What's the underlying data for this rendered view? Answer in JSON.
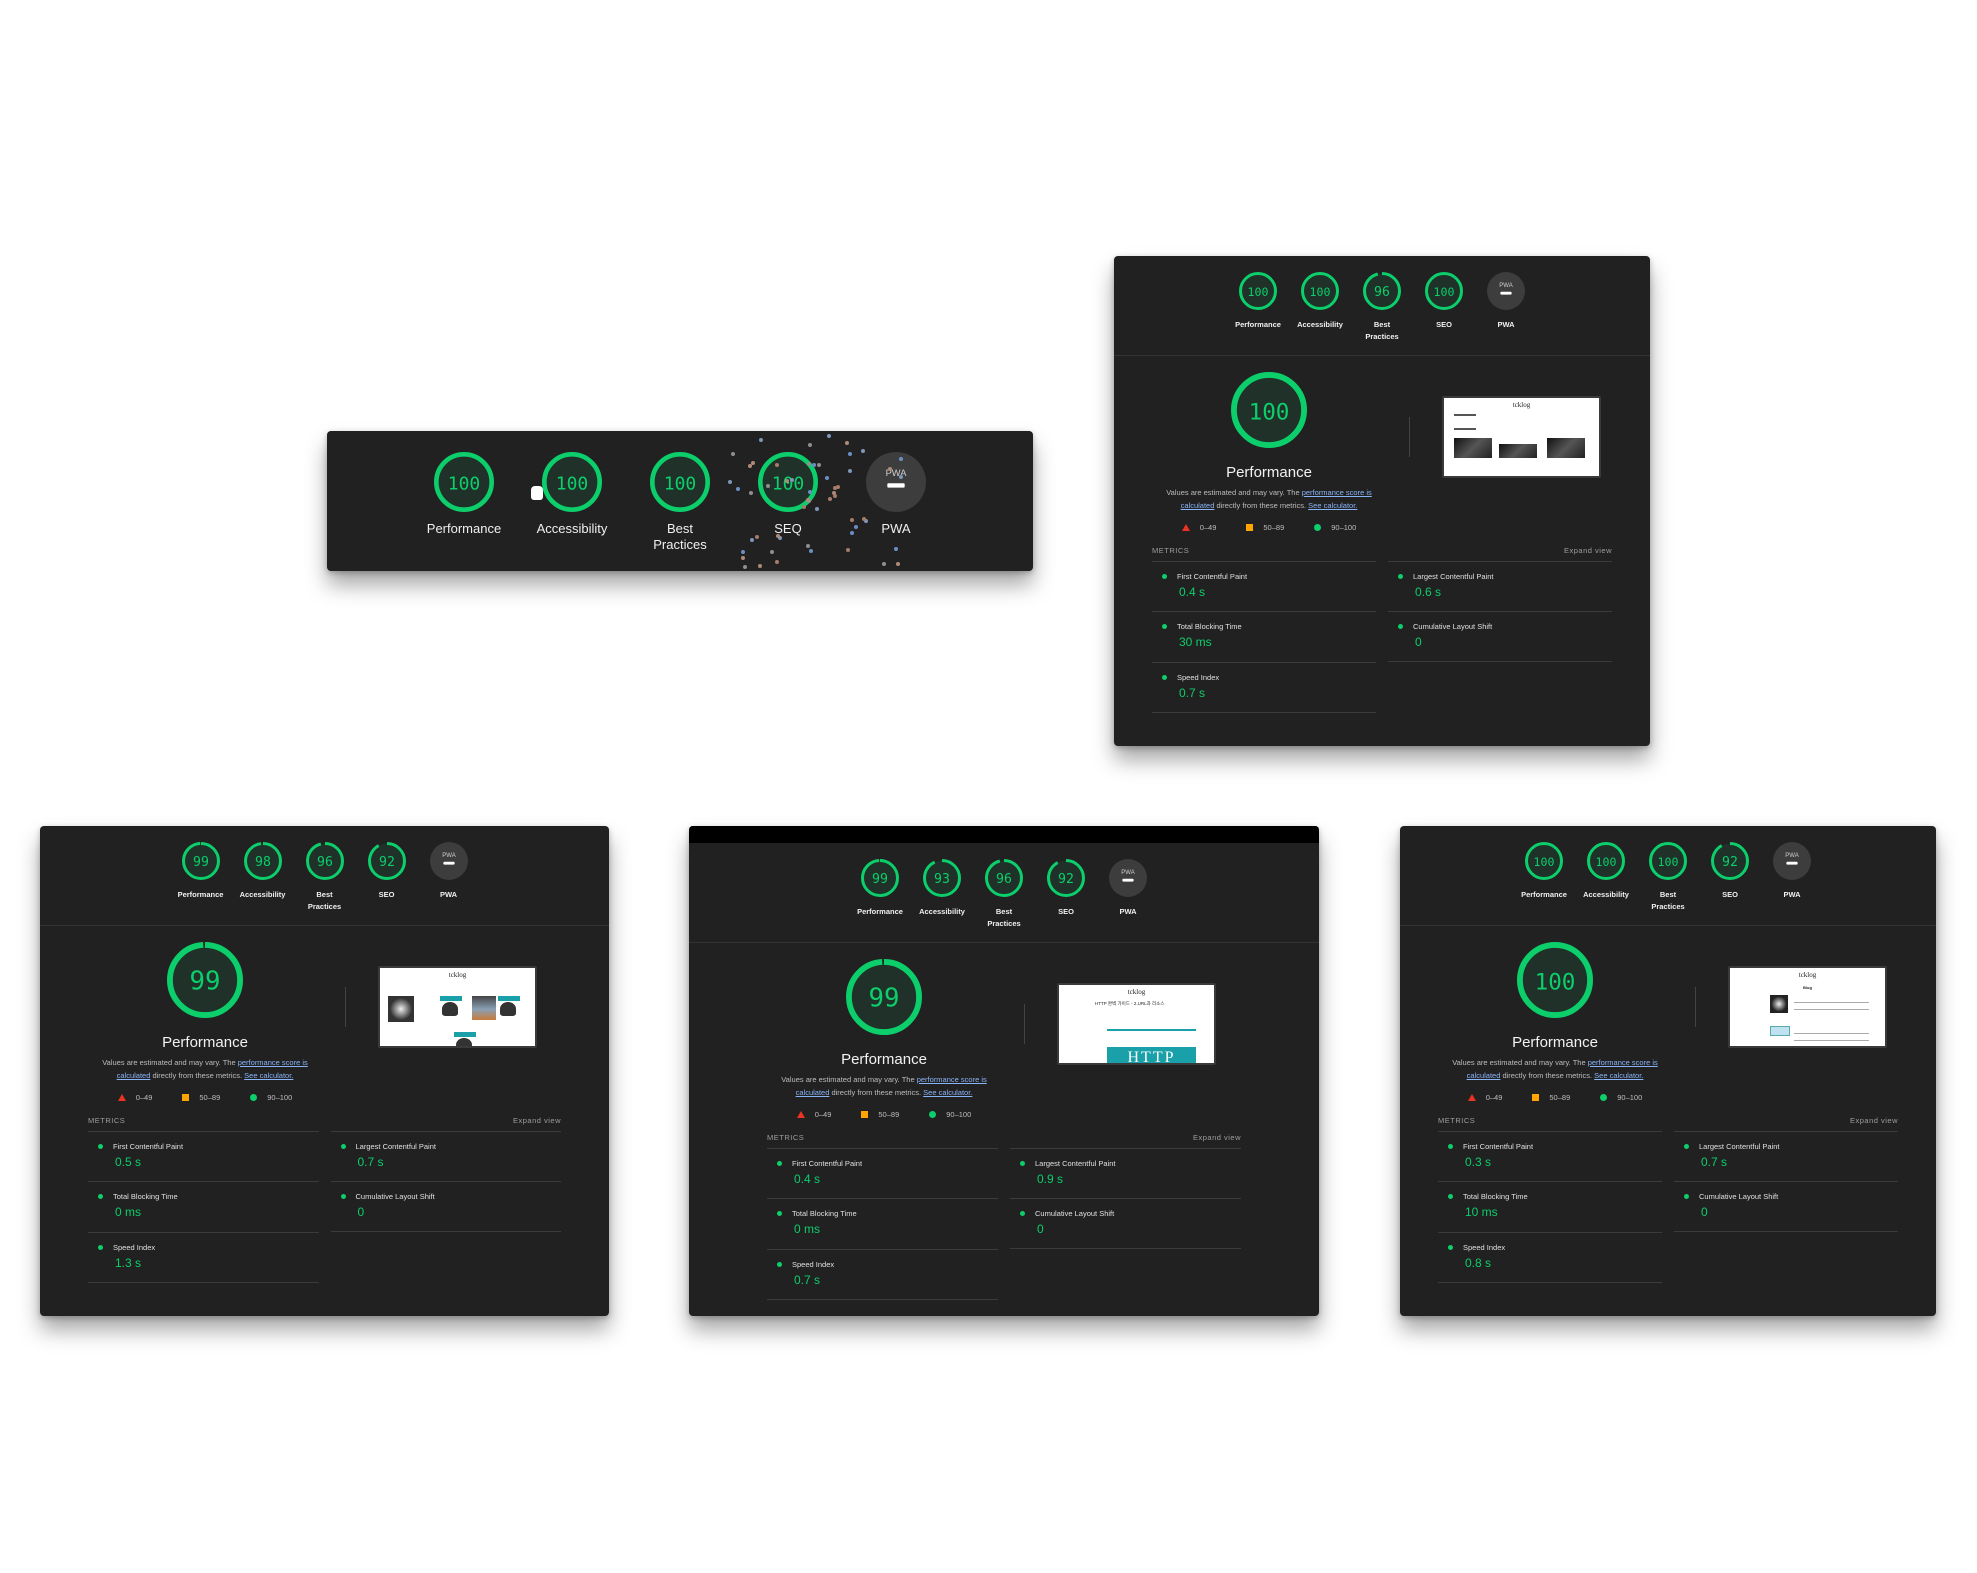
{
  "colors": {
    "pass": "#0cce6b",
    "average": "#ffa400",
    "fail": "#eb3323",
    "panel_bg": "#212121",
    "link": "#8ab4f8"
  },
  "common": {
    "category_labels": {
      "performance": "Performance",
      "accessibility": "Accessibility",
      "best_practices_line1": "Best",
      "best_practices_line2": "Practices",
      "seo": "SEO",
      "pwa": "PWA"
    },
    "pwa_badge": "PWA",
    "pwa_dash_icon": "minus-icon",
    "perf_title": "Performance",
    "note_prefix": "Values are estimated and may vary. The ",
    "note_link1": "performance score is calculated",
    "note_middle": " directly from these metrics. ",
    "note_link2": "See calculator.",
    "legend": [
      {
        "icon": "triangle-icon",
        "range": "0–49"
      },
      {
        "icon": "square-icon",
        "range": "50–89"
      },
      {
        "icon": "circle-icon",
        "range": "90–100"
      }
    ],
    "metrics_heading": "METRICS",
    "expand_view": "Expand view",
    "metric_names": {
      "fcp": "First Contentful Paint",
      "lcp": "Largest Contentful Paint",
      "tbt": "Total Blocking Time",
      "cls": "Cumulative Layout Shift",
      "si": "Speed Index"
    }
  },
  "strip": {
    "scores": {
      "performance": 100,
      "accessibility": 100,
      "best_practices": 100,
      "seo": 100
    },
    "seo_label_shown": "SEQ",
    "decoration": "confetti-animation"
  },
  "reports": [
    {
      "id": "home",
      "scores": {
        "performance": 100,
        "accessibility": 100,
        "best_practices": 96,
        "seo": 100
      },
      "thumbnail": "homepage-screenshot",
      "metrics": {
        "fcp": "0.4 s",
        "lcp": "0.6 s",
        "tbt": "30 ms",
        "cls": "0",
        "si": "0.7 s"
      }
    },
    {
      "id": "tags",
      "scores": {
        "performance": 99,
        "accessibility": 98,
        "best_practices": 96,
        "seo": 92
      },
      "thumbnail": "tag-list-screenshot",
      "metrics": {
        "fcp": "0.5 s",
        "lcp": "0.7 s",
        "tbt": "0 ms",
        "cls": "0",
        "si": "1.3 s"
      }
    },
    {
      "id": "post",
      "scores": {
        "performance": 99,
        "accessibility": 93,
        "best_practices": 96,
        "seo": 92
      },
      "thumbnail": "post-page-screenshot",
      "thumbnail_heading": "HTTP 완벽 가이드 - 2.URL과 리소스",
      "thumbnail_banner": "HTTP",
      "metrics": {
        "fcp": "0.4 s",
        "lcp": "0.9 s",
        "tbt": "0 ms",
        "cls": "0",
        "si": "0.7 s"
      }
    },
    {
      "id": "blog",
      "scores": {
        "performance": 100,
        "accessibility": 100,
        "best_practices": 100,
        "seo": 92
      },
      "thumbnail": "blog-list-screenshot",
      "thumbnail_heading": "Blog",
      "metrics": {
        "fcp": "0.3 s",
        "lcp": "0.7 s",
        "tbt": "10 ms",
        "cls": "0",
        "si": "0.8 s"
      }
    }
  ],
  "thumbnail_site_name": "tcklog"
}
